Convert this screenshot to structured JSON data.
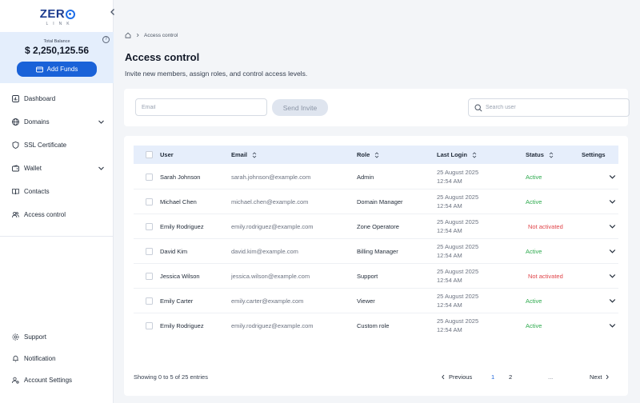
{
  "brand": {
    "logo_main": "ZER",
    "logo_sub": "LINK"
  },
  "balance": {
    "label": "Total Balance",
    "amount": "$ 2,250,125.56",
    "add_funds": "Add Funds"
  },
  "nav": {
    "items": [
      {
        "label": "Dashboard",
        "icon": "dashboard-icon"
      },
      {
        "label": "Domains",
        "icon": "globe-icon",
        "expandable": true
      },
      {
        "label": "SSL Certificate",
        "icon": "shield-icon"
      },
      {
        "label": "Wallet",
        "icon": "wallet-icon",
        "expandable": true
      },
      {
        "label": "Contacts",
        "icon": "book-icon"
      },
      {
        "label": "Access control",
        "icon": "users-icon"
      }
    ],
    "bottom_items": [
      {
        "label": "Support",
        "icon": "gear-icon"
      },
      {
        "label": "Notification",
        "icon": "bell-icon"
      },
      {
        "label": "Account Settings",
        "icon": "user-settings-icon"
      }
    ]
  },
  "breadcrumb": {
    "current": "Access control"
  },
  "page": {
    "title": "Access control",
    "subtitle": "Invite new members, assign roles, and control access levels."
  },
  "invite": {
    "email_placeholder": "Email",
    "send_label": "Send Invite",
    "search_placeholder": "Search user"
  },
  "table": {
    "headers": {
      "user": "User",
      "email": "Email",
      "role": "Role",
      "last_login": "Last Login",
      "status": "Status",
      "settings": "Settings"
    },
    "rows": [
      {
        "user": "Sarah Johnson",
        "email": "sarah.johnson@example.com",
        "role": "Admin",
        "date": "25 August 2025",
        "time": "12:54 AM",
        "status": "Active"
      },
      {
        "user": "Michael Chen",
        "email": "michael.chen@example.com",
        "role": "Domain Manager",
        "date": "25 August 2025",
        "time": "12:54 AM",
        "status": "Active"
      },
      {
        "user": "Emily Rodriguez",
        "email": "emily.rodriguez@example.com",
        "role": "Zone Operatore",
        "date": "25 August 2025",
        "time": "12:54 AM",
        "status": "Not activated"
      },
      {
        "user": "David Kim",
        "email": "david.kim@example.com",
        "role": "Billing Manager",
        "date": "25 August 2025",
        "time": "12:54 AM",
        "status": "Active"
      },
      {
        "user": "Jessica Wilson",
        "email": "jessica.wilson@example.com",
        "role": "Support",
        "date": "25 August 2025",
        "time": "12:54 AM",
        "status": "Not activated"
      },
      {
        "user": "Emily Carter",
        "email": "emily.carter@example.com",
        "role": "Viewer",
        "date": "25 August 2025",
        "time": "12:54 AM",
        "status": "Active"
      },
      {
        "user": "Emily Rodriguez",
        "email": "emily.rodriguez@example.com",
        "role": "Custom role",
        "date": "25 August 2025",
        "time": "12:54 AM",
        "status": "Active"
      }
    ]
  },
  "pagination": {
    "entries_text": "Showing 0 to 5 of 25 entries",
    "previous": "Previous",
    "pages": [
      "1",
      "2"
    ],
    "ellipsis": "...",
    "next": "Next",
    "current_page": "1"
  },
  "colors": {
    "primary": "#1a62d8",
    "active": "#2eaa4e",
    "inactive": "#e0454a",
    "balance_bg": "#e4eefc"
  }
}
